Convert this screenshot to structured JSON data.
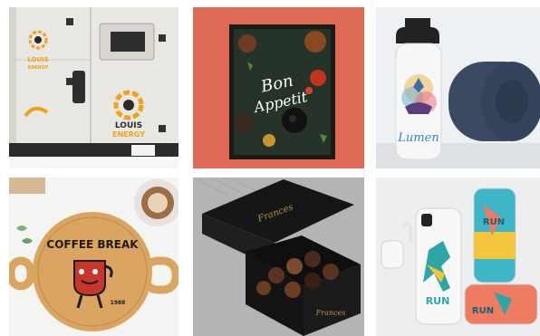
{
  "gallery": {
    "items": [
      {
        "subject": "generator",
        "lines": [
          "LOUIS",
          "ENERGY"
        ],
        "colors": {
          "panel": "#e9e7e2",
          "accent": "#f0a21a",
          "dark": "#2b2b2b"
        }
      },
      {
        "subject": "poster",
        "lines": [
          "Bon",
          "Appetit"
        ],
        "colors": {
          "wall": "#df6a55",
          "frame": "#1b1b1b",
          "board": "#253329"
        }
      },
      {
        "subject": "water-bottle-and-yoga-mat",
        "lines": [
          "Lumen"
        ],
        "colors": {
          "bg": "#eef1f3",
          "mat": "#3a4a63",
          "bottle": "#f7f7f7"
        }
      },
      {
        "subject": "serving-board",
        "lines": [
          "COFFEE BREAK",
          "1988"
        ],
        "colors": {
          "wood": "#d9a560",
          "ink": "#1c1c1c",
          "mug": "#c8362b"
        }
      },
      {
        "subject": "chocolate-box",
        "lines": [
          "Frances",
          "Frances"
        ],
        "colors": {
          "box": "#161616",
          "gold": "#b8904f"
        }
      },
      {
        "subject": "phone-cases",
        "lines": [
          "RUN",
          "RUN",
          "RUN"
        ],
        "colors": {
          "bg": "#eceef0",
          "teal": "#2fa6a6",
          "yellow": "#f2c53d",
          "coral": "#ef7b61"
        }
      }
    ]
  }
}
